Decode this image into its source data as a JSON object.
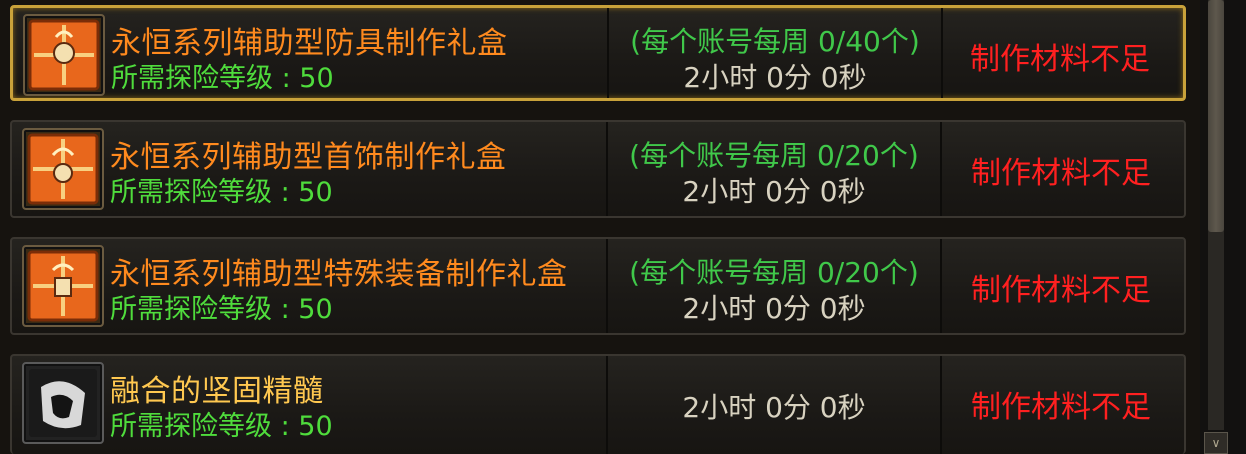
{
  "items": [
    {
      "name": "永恒系列辅助型防具制作礼盒",
      "level": "所需探险等级 : 50",
      "limit": "(每个账号每周 0/40个)",
      "time": "2小时 0分 0秒",
      "status": "制作材料不足",
      "icon": "orange-gift-box-icon"
    },
    {
      "name": "永恒系列辅助型首饰制作礼盒",
      "level": "所需探险等级 : 50",
      "limit": "(每个账号每周 0/20个)",
      "time": "2小时 0分 0秒",
      "status": "制作材料不足",
      "icon": "orange-gift-box-icon"
    },
    {
      "name": "永恒系列辅助型特殊装备制作礼盒",
      "level": "所需探险等级 : 50",
      "limit": "(每个账号每周 0/20个)",
      "time": "2小时 0分 0秒",
      "status": "制作材料不足",
      "icon": "orange-gift-box-icon"
    },
    {
      "name": "融合的坚固精髓",
      "level": "所需探险等级 : 50",
      "time": "2小时 0分 0秒",
      "status": "制作材料不足",
      "icon": "dark-essence-icon"
    }
  ],
  "scrollbar": {
    "down_arrow": "∨"
  },
  "colors": {
    "orange_name": "#ff8a1e",
    "gold_name": "#ffc850",
    "green": "#4fdc3c",
    "red_status": "#ff2020",
    "selected_border": "#c9a23a"
  }
}
